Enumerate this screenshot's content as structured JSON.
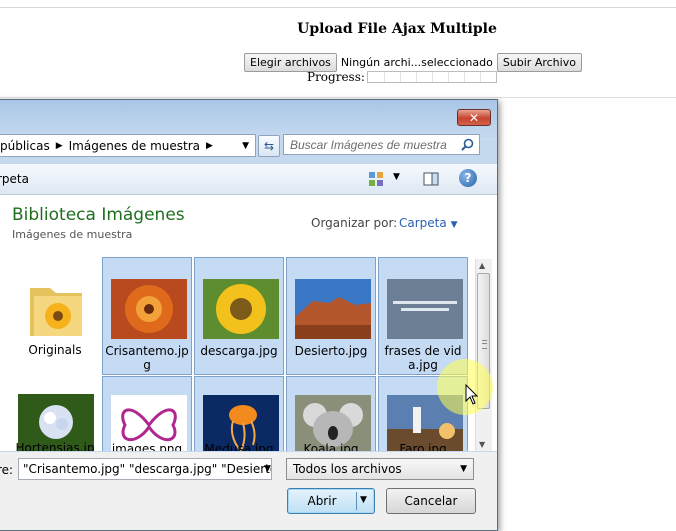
{
  "page": {
    "title": "Upload File Ajax Multiple",
    "choose_label": "Elegir archivos",
    "file_status": "Ningún archi...seleccionado",
    "submit_label": "Subir Archivo",
    "progress_label": "Progress:",
    "progress_value": 0
  },
  "dialog": {
    "close_glyph": "✕",
    "breadcrumb": [
      "públicas",
      "Imágenes de muestra"
    ],
    "search_placeholder": "Buscar Imágenes de muestra",
    "new_folder": "rpeta",
    "library_title": "Biblioteca Imágenes",
    "library_subtitle": "Imágenes de muestra",
    "organize_label": "Organizar por:",
    "organize_value": "Carpeta",
    "files_row1": [
      {
        "name": "Originals",
        "selected": false,
        "icon": "folder-icon"
      },
      {
        "name": "Crisantemo.jpg",
        "selected": true,
        "icon": "flower-thumb"
      },
      {
        "name": "descarga.jpg",
        "selected": true,
        "icon": "sunflower-thumb"
      },
      {
        "name": "Desierto.jpg",
        "selected": true,
        "icon": "desert-thumb"
      },
      {
        "name": "frases de vida.jpg",
        "selected": true,
        "icon": "quote-thumb"
      }
    ],
    "files_row2": [
      {
        "name": "Hortensias.jpg",
        "selected": false,
        "icon": "hydrangea-thumb"
      },
      {
        "name": "images.png",
        "selected": true,
        "icon": "butterfly-thumb"
      },
      {
        "name": "Medusa.jpg",
        "selected": true,
        "icon": "jellyfish-thumb"
      },
      {
        "name": "Koala.jpg",
        "selected": true,
        "icon": "koala-thumb"
      },
      {
        "name": "Faro.jpg",
        "selected": true,
        "icon": "lighthouse-thumb"
      }
    ],
    "filename_label": "re:",
    "filename_value": "\"Crisantemo.jpg\" \"descarga.jpg\" \"Desierto.jp",
    "filetype_value": "Todos los archivos",
    "open_label": "Abrir",
    "cancel_label": "Cancelar"
  },
  "colors": {
    "library_title": "#1e6e1e",
    "link": "#2b62b3",
    "selection": "#96bee6",
    "close_button": "#c7442f"
  }
}
